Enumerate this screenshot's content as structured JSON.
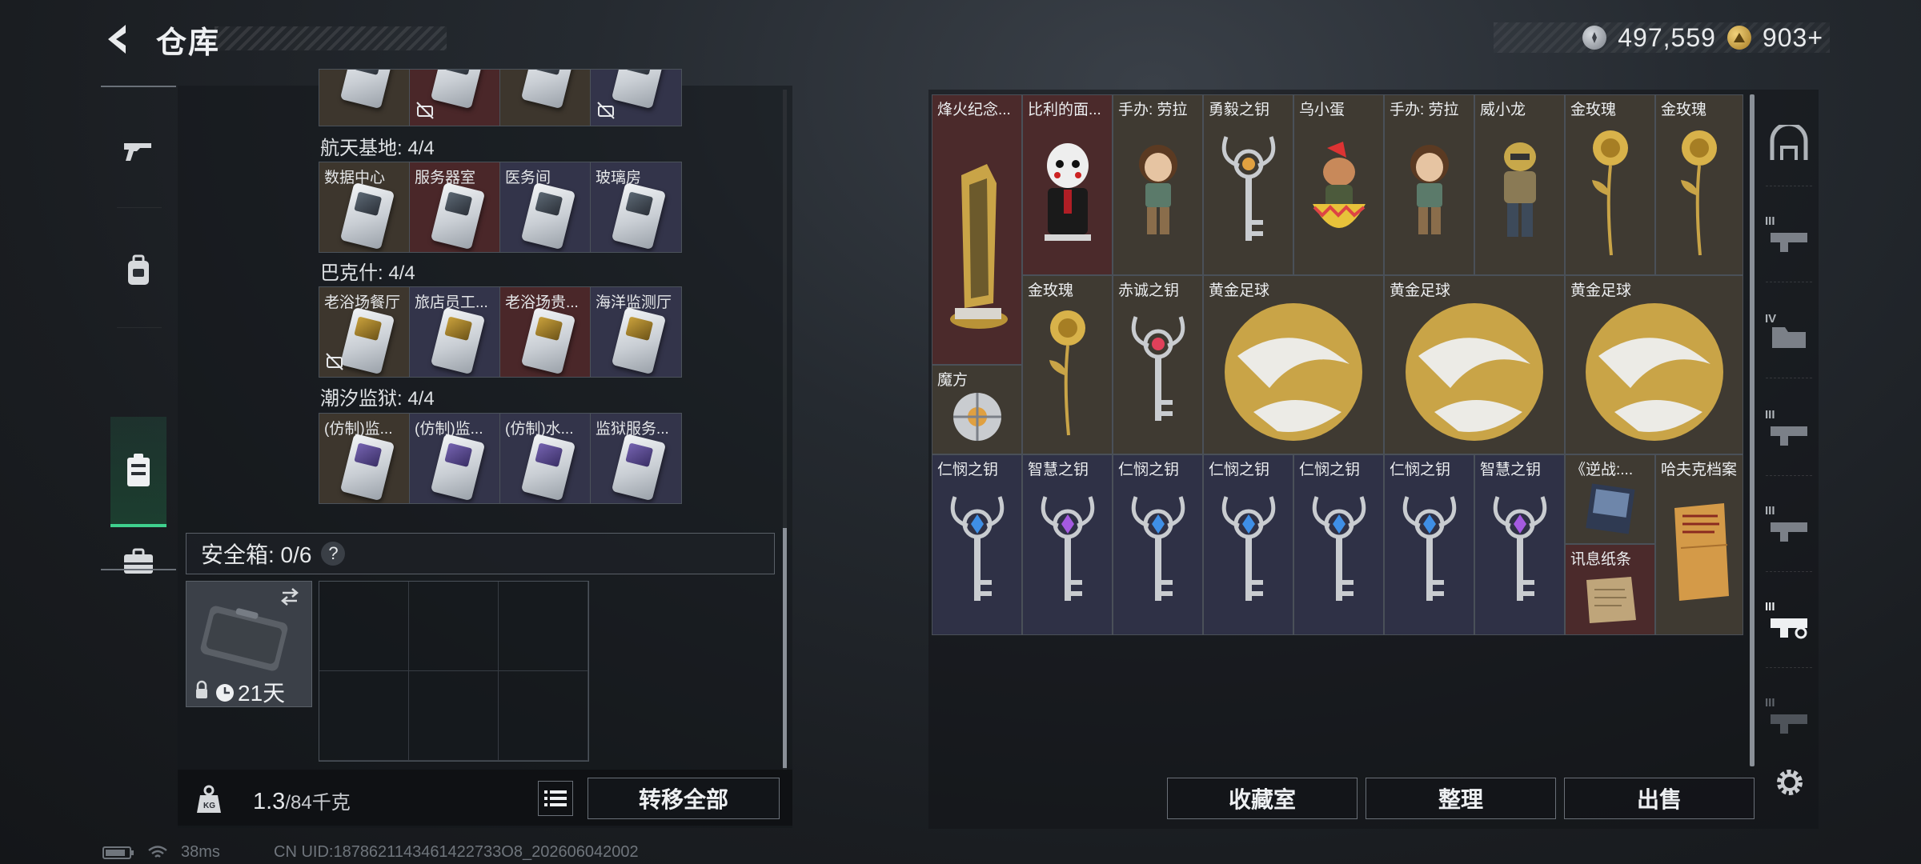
{
  "header": {
    "title": "仓库",
    "currency": [
      {
        "icon": "silver-coin-icon",
        "value": "497,559"
      },
      {
        "icon": "gold-triangle-coin-icon",
        "value": "903+"
      }
    ]
  },
  "left_nav": [
    {
      "icon": "gun-icon"
    },
    {
      "icon": "backpack-icon"
    },
    {
      "icon": "keycard-case-icon",
      "active": true
    },
    {
      "icon": "toolbox-icon"
    }
  ],
  "maps": [
    {
      "title": "",
      "cards": [
        {
          "label": "",
          "color": "brown",
          "mark": false
        },
        {
          "label": "",
          "color": "red",
          "mark": true
        },
        {
          "label": "",
          "color": "brown",
          "mark": false
        },
        {
          "label": "",
          "color": "blue",
          "mark": true
        }
      ]
    },
    {
      "title": "航天基地: 4/4",
      "cards": [
        {
          "label": "数据中心",
          "color": "brown"
        },
        {
          "label": "服务器室",
          "color": "red"
        },
        {
          "label": "医务间",
          "color": "blue"
        },
        {
          "label": "玻璃房",
          "color": "blue"
        }
      ]
    },
    {
      "title": "巴克什: 4/4",
      "cards": [
        {
          "label": "老浴场餐厅",
          "color": "brown",
          "mark": true
        },
        {
          "label": "旅店员工...",
          "color": "blue"
        },
        {
          "label": "老浴场贵...",
          "color": "red"
        },
        {
          "label": "海洋监测厅",
          "color": "blue"
        }
      ]
    },
    {
      "title": "潮汐监狱: 4/4",
      "cards": [
        {
          "label": "(仿制)监...",
          "color": "brown"
        },
        {
          "label": "(仿制)监...",
          "color": "blue"
        },
        {
          "label": "(仿制)水...",
          "color": "blue"
        },
        {
          "label": "监狱服务...",
          "color": "blue"
        }
      ]
    }
  ],
  "safe_box": {
    "label": "安全箱: 0/6",
    "help": "?",
    "duration": "21天"
  },
  "weight": {
    "current": "1.3",
    "max": "/84千克"
  },
  "buttons": {
    "transfer_all": "转移全部",
    "collection": "收藏室",
    "sort": "整理",
    "sell": "出售"
  },
  "stash_items": [
    {
      "id": "beacon",
      "label": "烽火纪念...",
      "bg": "red"
    },
    {
      "id": "billy",
      "label": "比利的面...",
      "bg": "red"
    },
    {
      "id": "lara1",
      "label": "手办: 劳拉",
      "bg": "brown"
    },
    {
      "id": "brave-key",
      "label": "勇毅之钥",
      "bg": "brown"
    },
    {
      "id": "crow-egg",
      "label": "乌小蛋",
      "bg": "brown"
    },
    {
      "id": "lara2",
      "label": "手办: 劳拉",
      "bg": "brown"
    },
    {
      "id": "wei-dragon",
      "label": "威小龙",
      "bg": "brown"
    },
    {
      "id": "rose1",
      "label": "金玫瑰",
      "bg": "brown"
    },
    {
      "id": "rose2",
      "label": "金玫瑰",
      "bg": "brown"
    },
    {
      "id": "cube",
      "label": "魔方",
      "bg": "brown"
    },
    {
      "id": "rose3",
      "label": "金玫瑰",
      "bg": "brown"
    },
    {
      "id": "red-key",
      "label": "赤诚之钥",
      "bg": "brown"
    },
    {
      "id": "ball1",
      "label": "黄金足球",
      "bg": "brown"
    },
    {
      "id": "ball2",
      "label": "黄金足球",
      "bg": "brown"
    },
    {
      "id": "ball3",
      "label": "黄金足球",
      "bg": "brown"
    },
    {
      "id": "k1",
      "label": "仁悯之钥",
      "bg": "blue",
      "gem": "#3f8fe6"
    },
    {
      "id": "k2",
      "label": "智慧之钥",
      "bg": "blue",
      "gem": "#a45ae0"
    },
    {
      "id": "k3",
      "label": "仁悯之钥",
      "bg": "blue",
      "gem": "#3f8fe6"
    },
    {
      "id": "k4",
      "label": "仁悯之钥",
      "bg": "blue",
      "gem": "#3f8fe6"
    },
    {
      "id": "k5",
      "label": "仁悯之钥",
      "bg": "blue",
      "gem": "#3f8fe6"
    },
    {
      "id": "k6",
      "label": "仁悯之钥",
      "bg": "blue",
      "gem": "#3f8fe6"
    },
    {
      "id": "k7",
      "label": "智慧之钥",
      "bg": "blue",
      "gem": "#a45ae0"
    },
    {
      "id": "book",
      "label": "《逆战:...",
      "bg": "brown"
    },
    {
      "id": "note",
      "label": "讯息纸条",
      "bg": "red"
    },
    {
      "id": "dossier",
      "label": "哈夫克档案",
      "bg": "brown"
    }
  ],
  "side_tiers": [
    "III",
    "IV",
    "III",
    "III",
    "III",
    "III"
  ],
  "footer": {
    "ping": "38ms",
    "uid": "CN UID:1878621143461422733O8_202606042002"
  },
  "colors": {
    "accent_green": "#3fd08e",
    "gold": "#d8b24a"
  }
}
